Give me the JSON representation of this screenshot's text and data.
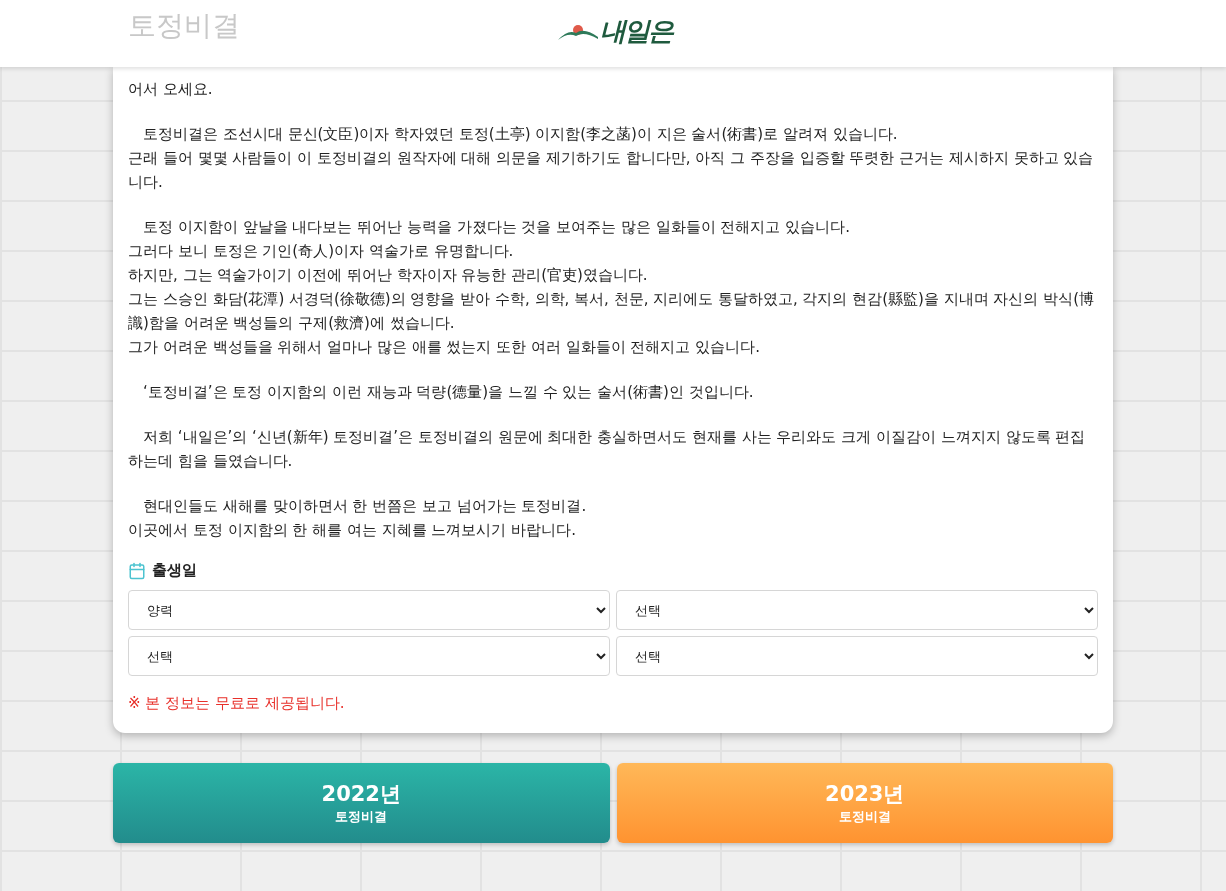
{
  "header": {
    "title": "토정비결",
    "logo": "내일은"
  },
  "intro": {
    "paragraphs": [
      {
        "indent": false,
        "lines": [
          "어서 오세요."
        ]
      },
      {
        "indent": true,
        "lines": [
          "토정비결은 조선시대 문신(文臣)이자 학자였던 토정(土亭) 이지함(李之菡)이 지은 술서(術書)로 알려져 있습니다.",
          "근래 들어 몇몇 사람들이 이 토정비결의 원작자에 대해 의문을 제기하기도 합니다만, 아직 그 주장을 입증할 뚜렷한 근거는 제시하지 못하고 있습니다."
        ]
      },
      {
        "indent": true,
        "lines": [
          "토정 이지함이 앞날을 내다보는 뛰어난 능력을 가졌다는 것을 보여주는 많은 일화들이 전해지고 있습니다.",
          "그러다 보니 토정은 기인(奇人)이자 역술가로 유명합니다.",
          "하지만, 그는 역술가이기 이전에 뛰어난 학자이자 유능한 관리(官吏)였습니다.",
          "그는 스승인 화담(花潭) 서경덕(徐敬德)의 영향을 받아 수학, 의학, 복서, 천문, 지리에도 통달하였고, 각지의 현감(縣監)을 지내며 자신의 박식(博識)함을 어려운 백성들의 구제(救濟)에 썼습니다.",
          "그가 어려운 백성들을 위해서 얼마나 많은 애를 썼는지 또한 여러 일화들이 전해지고 있습니다."
        ]
      },
      {
        "indent": true,
        "lines": [
          "‘토정비결’은 토정 이지함의 이런 재능과 덕량(德量)을 느낄 수 있는 술서(術書)인 것입니다."
        ]
      },
      {
        "indent": true,
        "lines": [
          "저희 ‘내일은’의 ‘신년(新年) 토정비결’은 토정비결의 원문에 최대한 충실하면서도 현재를 사는 우리와도 크게 이질감이 느껴지지 않도록 편집하는데 힘을 들였습니다."
        ]
      },
      {
        "indent": true,
        "lines": [
          "현대인들도 새해를 맞이하면서 한 번쯤은 보고 넘어가는 토정비결.",
          "이곳에서 토정 이지함의 한 해를 여는 지혜를 느껴보시기 바랍니다."
        ]
      }
    ]
  },
  "birth": {
    "label": "출생일",
    "selects": [
      {
        "value": "양력"
      },
      {
        "value": "선택"
      },
      {
        "value": "선택"
      },
      {
        "value": "선택"
      }
    ],
    "notice": "※ 본 정보는 무료로 제공됩니다."
  },
  "buttons": [
    {
      "year": "2022년",
      "label": "토정비결",
      "kind": "teal"
    },
    {
      "year": "2023년",
      "label": "토정비결",
      "kind": "orange"
    }
  ]
}
